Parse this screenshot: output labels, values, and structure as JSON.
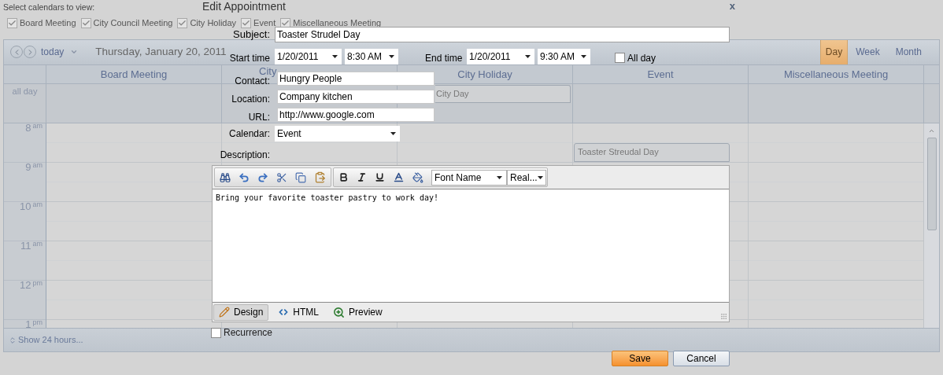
{
  "calendar_filter": {
    "label": "Select calendars to view:",
    "calendars": [
      {
        "label": "Board Meeting",
        "checked": true
      },
      {
        "label": "City Council Meeting",
        "checked": true
      },
      {
        "label": "City Holiday",
        "checked": true
      },
      {
        "label": "Event",
        "checked": true
      },
      {
        "label": "Miscellaneous Meeting",
        "checked": true
      }
    ]
  },
  "scheduler": {
    "today": "today",
    "date": "Thursday, January 20, 2011",
    "views": [
      {
        "label": "Day",
        "selected": true
      },
      {
        "label": "Week",
        "selected": false
      },
      {
        "label": "Month",
        "selected": false
      }
    ],
    "all_day_label": "all day",
    "columns": [
      {
        "title": "Board Meeting"
      },
      {
        "title": "City"
      },
      {
        "title": "City Holiday",
        "appointments": [
          {
            "kind": "all_day",
            "title": "City Day"
          }
        ]
      },
      {
        "title": "Event",
        "appointments": [
          {
            "kind": "timed",
            "title": "Toaster Streudal Day"
          }
        ]
      },
      {
        "title": "Miscellaneous Meeting"
      }
    ],
    "hours": [
      {
        "hour": "8",
        "suffix": "am"
      },
      {
        "hour": "9",
        "suffix": "am"
      },
      {
        "hour": "10",
        "suffix": "am"
      },
      {
        "hour": "11",
        "suffix": "am"
      },
      {
        "hour": "12",
        "suffix": "pm"
      },
      {
        "hour": "1",
        "suffix": "pm"
      }
    ],
    "show_24": "Show 24 hours..."
  },
  "dialog": {
    "title": "Edit Appointment",
    "close": "x",
    "subject_label": "Subject:",
    "subject": "Toaster Strudel Day",
    "start_label": "Start time",
    "start_date": "1/20/2011",
    "start_time": "8:30 AM",
    "end_label": "End time",
    "end_date": "1/20/2011",
    "end_time": "9:30 AM",
    "all_day": {
      "label": "All day",
      "checked": false
    },
    "fields": [
      {
        "label": "Contact:",
        "value": "Hungry People"
      },
      {
        "label": "Location:",
        "value": "Company kitchen"
      },
      {
        "label": "URL:",
        "value": "http://www.google.com"
      }
    ],
    "calendar_label": "Calendar:",
    "calendar": "Event",
    "description_label": "Description:",
    "editor": {
      "font_name": "Font Name",
      "font_size": "Real...",
      "content": "Bring your favorite toaster pastry to work day!",
      "modes": [
        {
          "label": "Design",
          "kind": "design",
          "selected": true
        },
        {
          "label": "HTML",
          "kind": "html",
          "selected": false
        },
        {
          "label": "Preview",
          "kind": "preview",
          "selected": false
        }
      ]
    },
    "recurrence": {
      "label": "Recurrence",
      "checked": false
    },
    "buttons": [
      {
        "label": "Save",
        "kind": "primary"
      },
      {
        "label": "Cancel",
        "kind": "secondary"
      }
    ]
  }
}
